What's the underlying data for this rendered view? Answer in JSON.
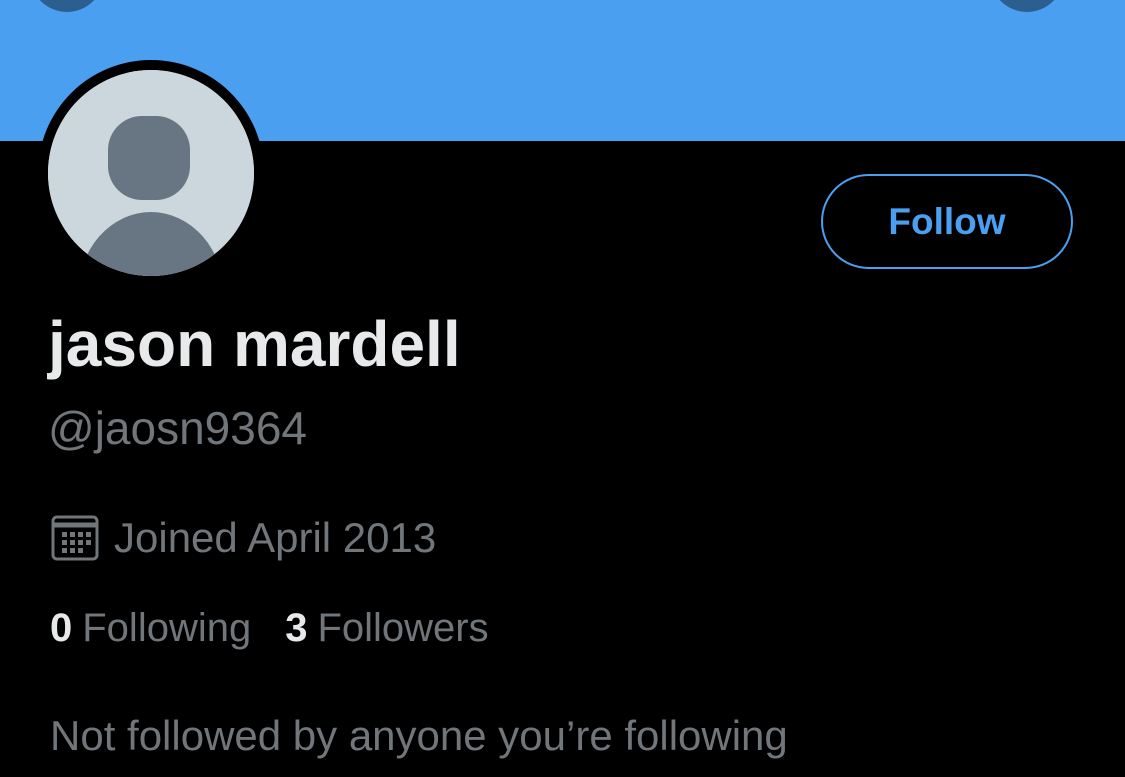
{
  "colors": {
    "banner": "#4a9ff0",
    "background": "#000000",
    "accent": "#4a9ff0",
    "primary_text": "#e7e9ea",
    "secondary_text": "#71767b",
    "avatar_bg": "#ccd6dd",
    "avatar_figure": "#687684"
  },
  "icons": {
    "calendar": "calendar-icon",
    "avatar": "default-avatar-silhouette"
  },
  "profile": {
    "name": "jason mardell",
    "handle": "@jaosn9364",
    "joined": "Joined April 2013",
    "follow_label": "Follow",
    "following_count": "0",
    "following_label": "Following",
    "followers_count": "3",
    "followers_label": "Followers",
    "not_followed_text": "Not followed by anyone you’re following"
  }
}
